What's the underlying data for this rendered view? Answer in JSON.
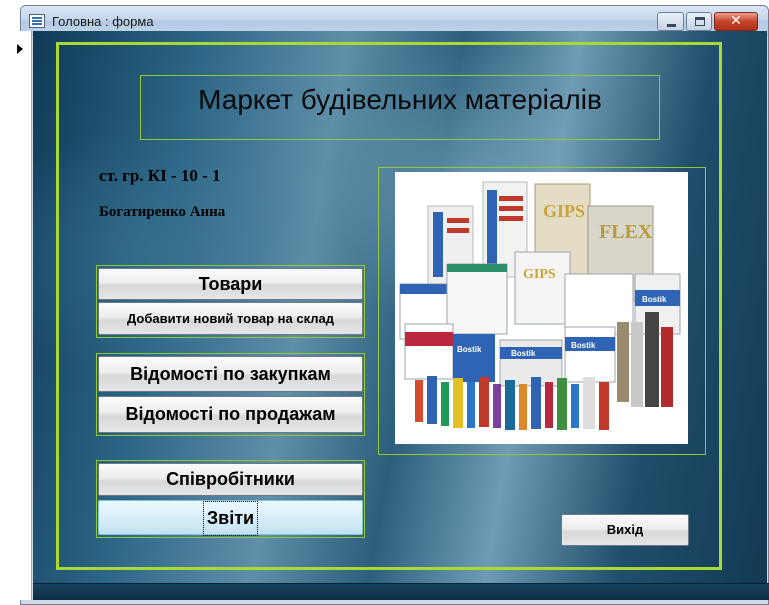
{
  "window": {
    "title": "Головна : форма"
  },
  "header": {
    "title": "Маркет будівельних матеріалів"
  },
  "info": {
    "group": "ст. гр. КІ - 10 - 1",
    "author": "Богатиренко Анна"
  },
  "buttons": {
    "goods": "Товари",
    "add_goods": "Добавити новий товар на склад",
    "purchases": "Відомості по закупкам",
    "sales": "Відомості по продажам",
    "employees": "Співробітники",
    "reports": "Звіти",
    "exit": "Вихід"
  },
  "image_labels": {
    "gips": "GIPS",
    "flex": "FLEX",
    "bostik": "Bostik"
  },
  "colors": {
    "accent_green": "#a9d933",
    "background_blue": "#2c6585"
  }
}
